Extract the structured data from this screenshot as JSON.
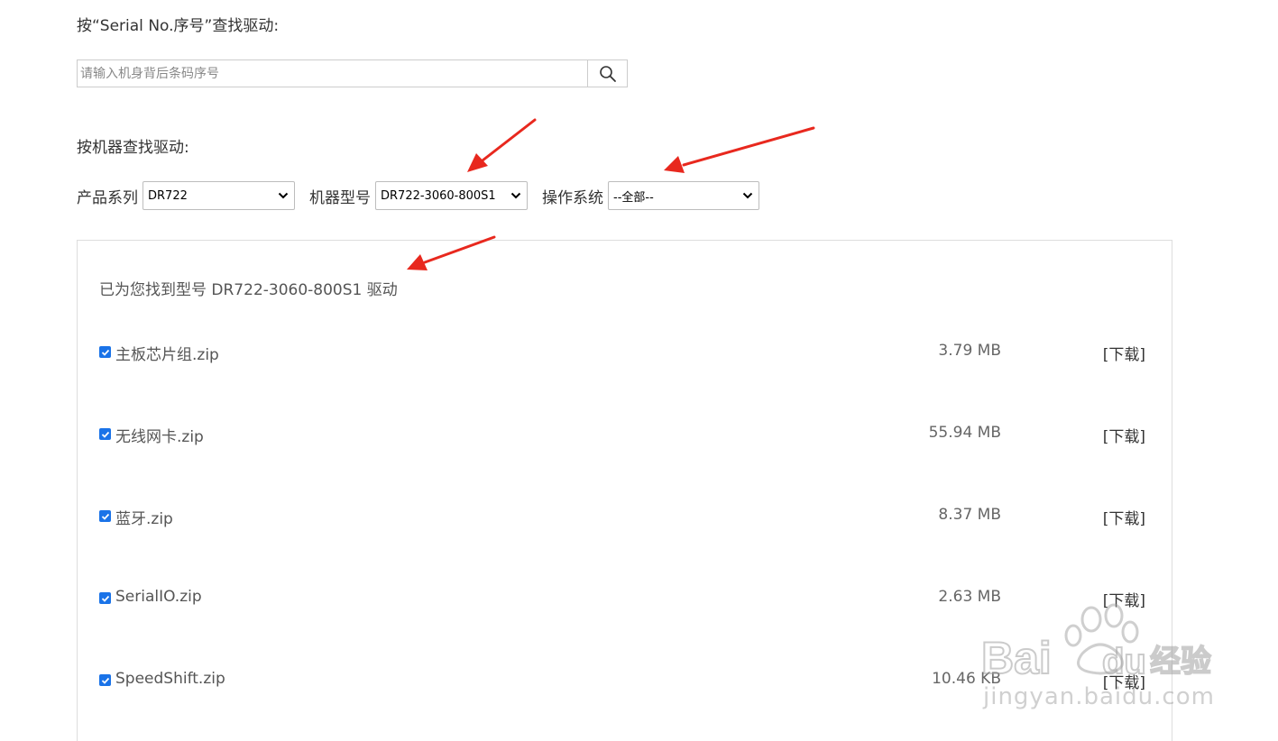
{
  "serial_section": {
    "heading": "按“Serial No.序号”查找驱动:",
    "search_placeholder": "请输入机身背后条码序号"
  },
  "model_section": {
    "heading": "按机器查找驱动:",
    "series_label": "产品系列",
    "series_value": "DR722",
    "model_label": "机器型号",
    "model_value": "DR722-3060-800S1",
    "os_label": "操作系统",
    "os_value": "--全部--"
  },
  "results": {
    "title": "已为您找到型号 DR722-3060-800S1 驱动",
    "files": [
      {
        "name": "主板芯片组.zip",
        "size": "3.79 MB",
        "action": "[下载]",
        "checked": true
      },
      {
        "name": "无线网卡.zip",
        "size": "55.94 MB",
        "action": "[下载]",
        "checked": true
      },
      {
        "name": "蓝牙.zip",
        "size": "8.37 MB",
        "action": "[下载]",
        "checked": true
      },
      {
        "name": "SerialIO.zip",
        "size": "2.63 MB",
        "action": "[下载]",
        "checked": true
      },
      {
        "name": "SpeedShift.zip",
        "size": "10.46 KB",
        "action": "[下载]",
        "checked": true
      }
    ]
  },
  "watermark": {
    "text": "jingyan.baidu.com",
    "logo": "Baidu 经验"
  },
  "colors": {
    "annotation_arrow": "#e8281e",
    "checkbox": "#1a73e8"
  }
}
